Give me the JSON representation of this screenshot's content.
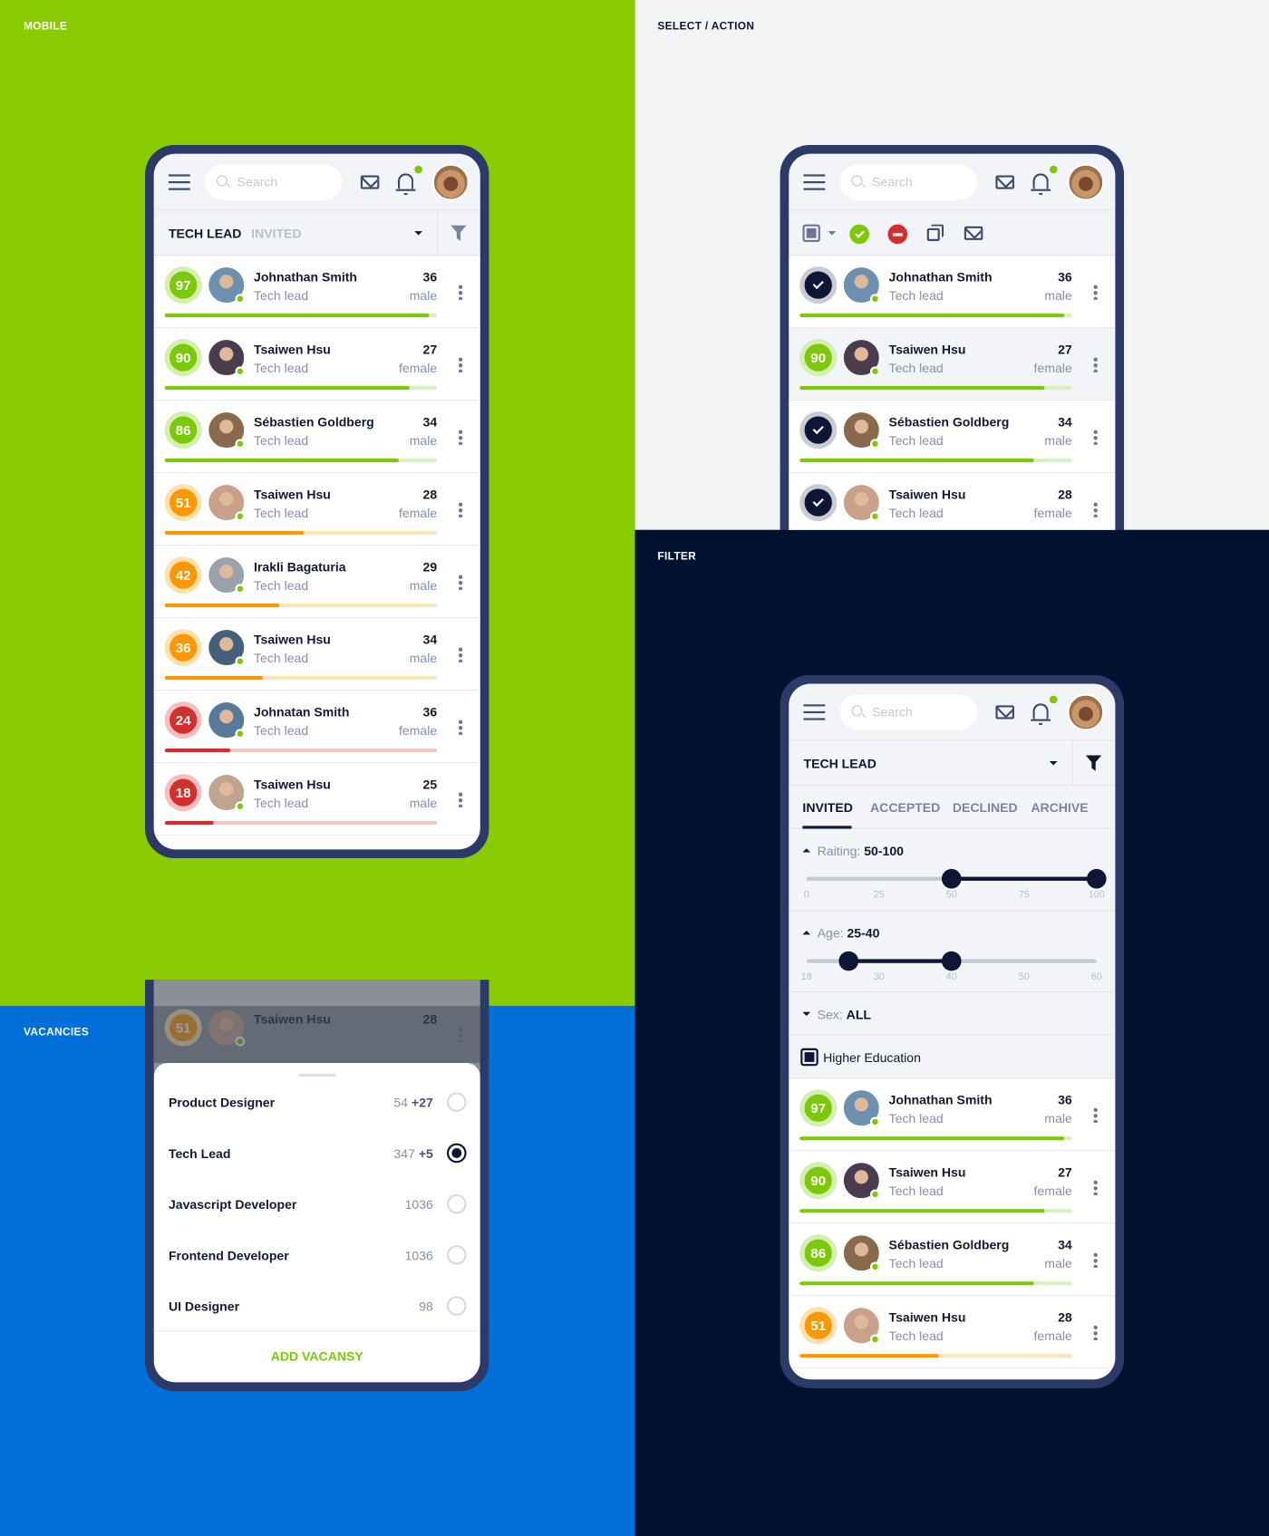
{
  "colors": {
    "mobile_bg": "#88cc00",
    "select_bg": "#f3f4f6",
    "filter_bg": "#00122f",
    "vacancies_bg": "#0070d9",
    "frame": "#2b3a67",
    "green": "#7cc90a",
    "orange": "#ff9800",
    "red": "#d32f2f",
    "navy": "#0d1634"
  },
  "labels": {
    "mobile": "MOBILE",
    "select": "SELECT / ACTION",
    "filter": "FILTER",
    "vacancies": "VACANCIES"
  },
  "header": {
    "search_placeholder": "Search",
    "icons": [
      "menu-icon",
      "search-icon",
      "mail-icon",
      "bell-icon",
      "avatar"
    ]
  },
  "mobile": {
    "vacancy": "TECH LEAD",
    "status": "INVITED"
  },
  "candidates": [
    {
      "score": 97,
      "name": "Johnathan Smith",
      "role": "Tech lead",
      "age": "36",
      "sex": "male"
    },
    {
      "score": 90,
      "name": "Tsaiwen Hsu",
      "role": "Tech lead",
      "age": "27",
      "sex": "female"
    },
    {
      "score": 86,
      "name": "Sébastien Goldberg",
      "role": "Tech lead",
      "age": "34",
      "sex": "male"
    },
    {
      "score": 51,
      "name": "Tsaiwen Hsu",
      "role": "Tech lead",
      "age": "28",
      "sex": "female"
    },
    {
      "score": 42,
      "name": "Irakli Bagaturia",
      "role": "Tech lead",
      "age": "29",
      "sex": "male"
    },
    {
      "score": 36,
      "name": "Tsaiwen Hsu",
      "role": "Tech lead",
      "age": "34",
      "sex": "male"
    },
    {
      "score": 24,
      "name": "Johnatan Smith",
      "role": "Tech lead",
      "age": "36",
      "sex": "female"
    },
    {
      "score": 18,
      "name": "Tsaiwen Hsu",
      "role": "Tech lead",
      "age": "25",
      "sex": "male"
    }
  ],
  "select": {
    "toolbar": [
      "select-all-checkbox",
      "approve-icon",
      "decline-icon",
      "copy-icon",
      "mail-icon"
    ],
    "selected": [
      true,
      false,
      true,
      true
    ]
  },
  "filter": {
    "vacancy": "TECH LEAD",
    "tabs": [
      "INVITED",
      "ACCEPTED",
      "DECLINED",
      "ARCHIVE"
    ],
    "active_tab": 0,
    "rating": {
      "label": "Raiting:",
      "value": "50-100",
      "min": 50,
      "max": 100,
      "ticks": [
        "0",
        "25",
        "50",
        "75",
        "100"
      ]
    },
    "age": {
      "label": "Age:",
      "value": "25-40",
      "min": 25,
      "max": 40,
      "ticks": [
        "18",
        "30",
        "40",
        "50",
        "60"
      ]
    },
    "sex": {
      "label": "Sex:",
      "value": "ALL"
    },
    "higher_education": {
      "label": "Higher Education",
      "checked": true
    }
  },
  "vacancies": {
    "items": [
      {
        "name": "Product Designer",
        "count": "54",
        "new": "+27",
        "selected": false
      },
      {
        "name": "Tech Lead",
        "count": "347",
        "new": "+5",
        "selected": true
      },
      {
        "name": "Javascript Developer",
        "count": "1036",
        "new": "",
        "selected": false
      },
      {
        "name": "Frontend Developer",
        "count": "1036",
        "new": "",
        "selected": false
      },
      {
        "name": "UI Designer",
        "count": "98",
        "new": "",
        "selected": false
      }
    ],
    "add_label": "ADD VACANSY"
  }
}
